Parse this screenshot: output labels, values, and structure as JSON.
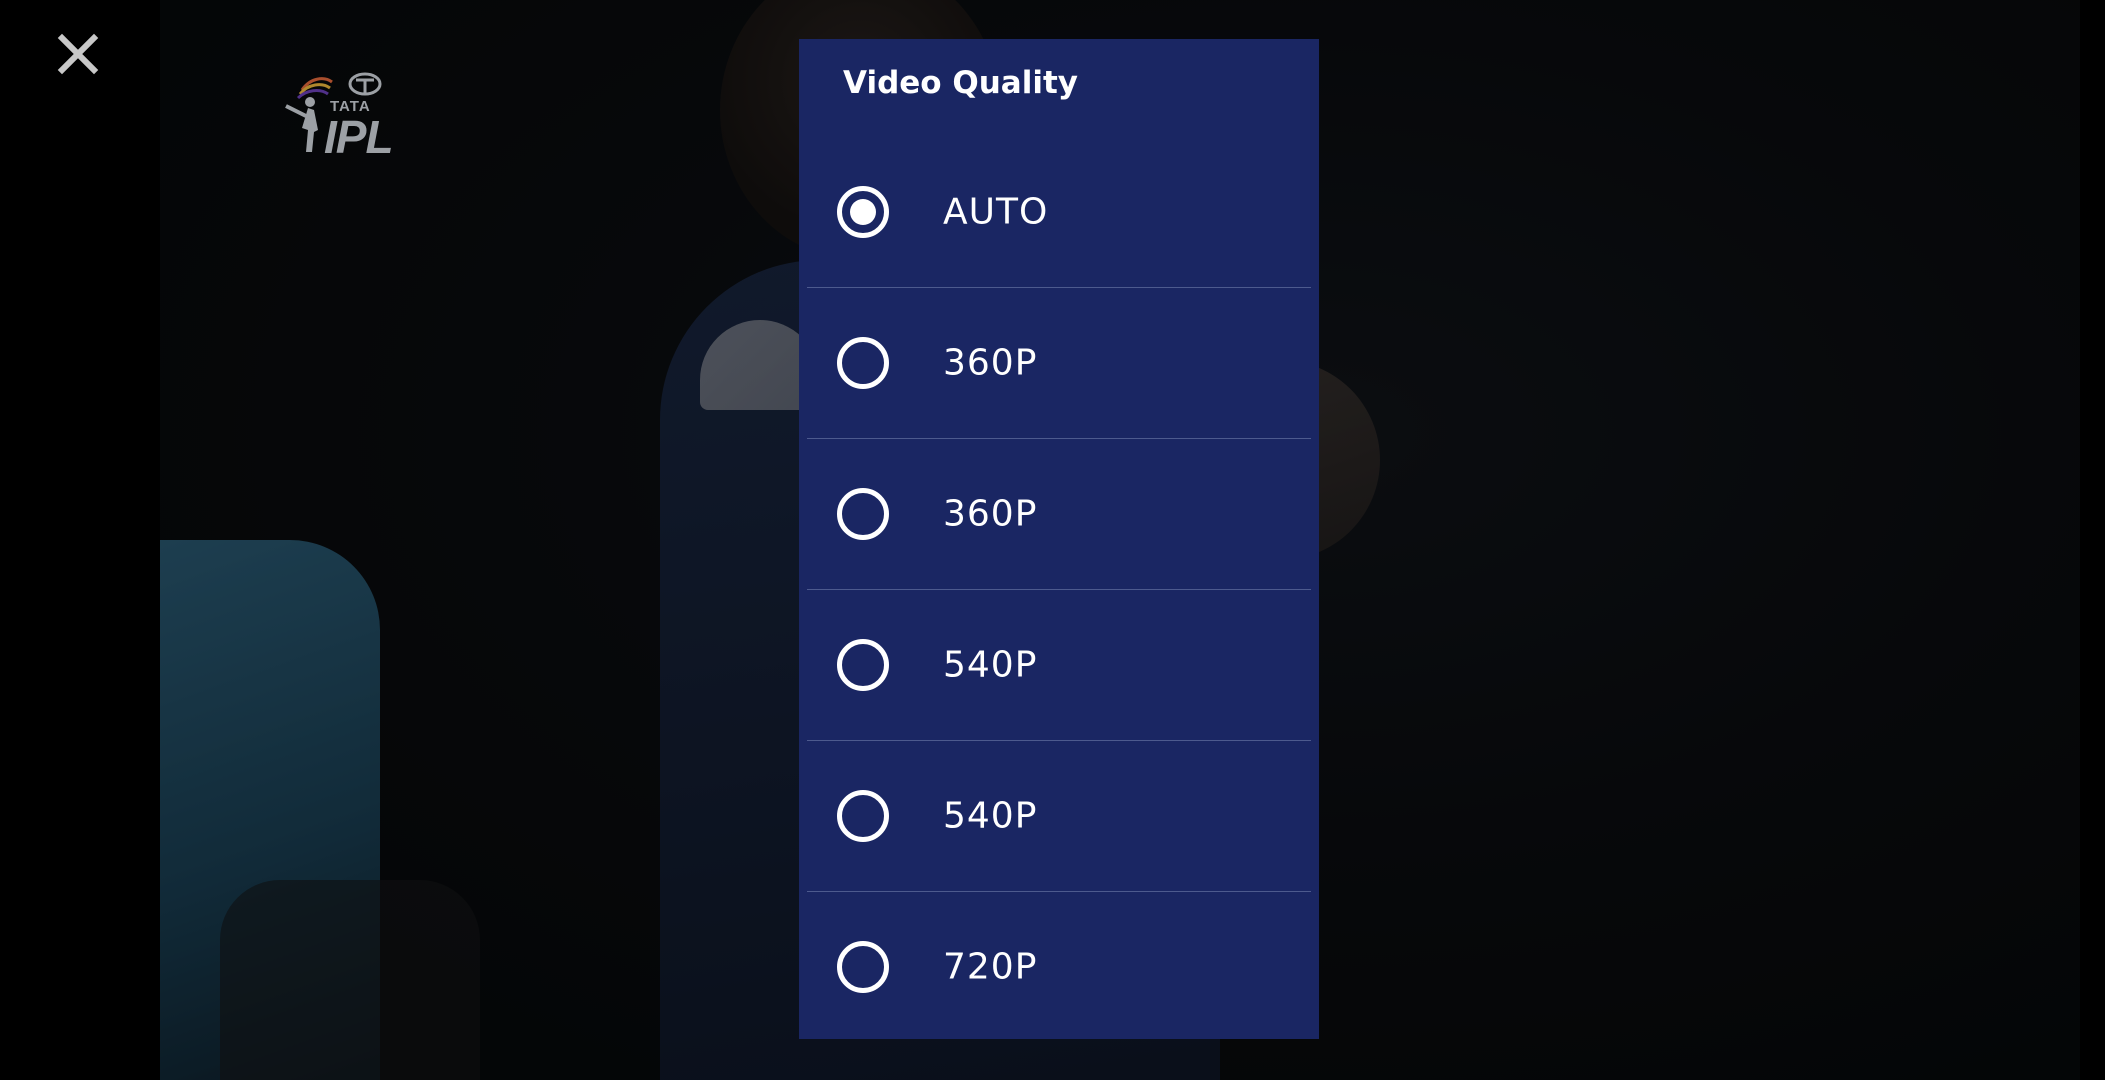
{
  "player": {
    "close_icon": "close-icon",
    "logo": {
      "brand_top": "TATA",
      "brand_main": "IPL"
    }
  },
  "quality_menu": {
    "title": "Video Quality",
    "selected_index": 0,
    "options": [
      {
        "label": "AUTO",
        "selected": true
      },
      {
        "label": "360P",
        "selected": false
      },
      {
        "label": "360P",
        "selected": false
      },
      {
        "label": "540P",
        "selected": false
      },
      {
        "label": "540P",
        "selected": false
      },
      {
        "label": "720P",
        "selected": false
      }
    ]
  },
  "colors": {
    "panel_bg": "#1a2663",
    "divider": "#4d5a8e",
    "text": "#ffffff",
    "backdrop": "#000000"
  }
}
